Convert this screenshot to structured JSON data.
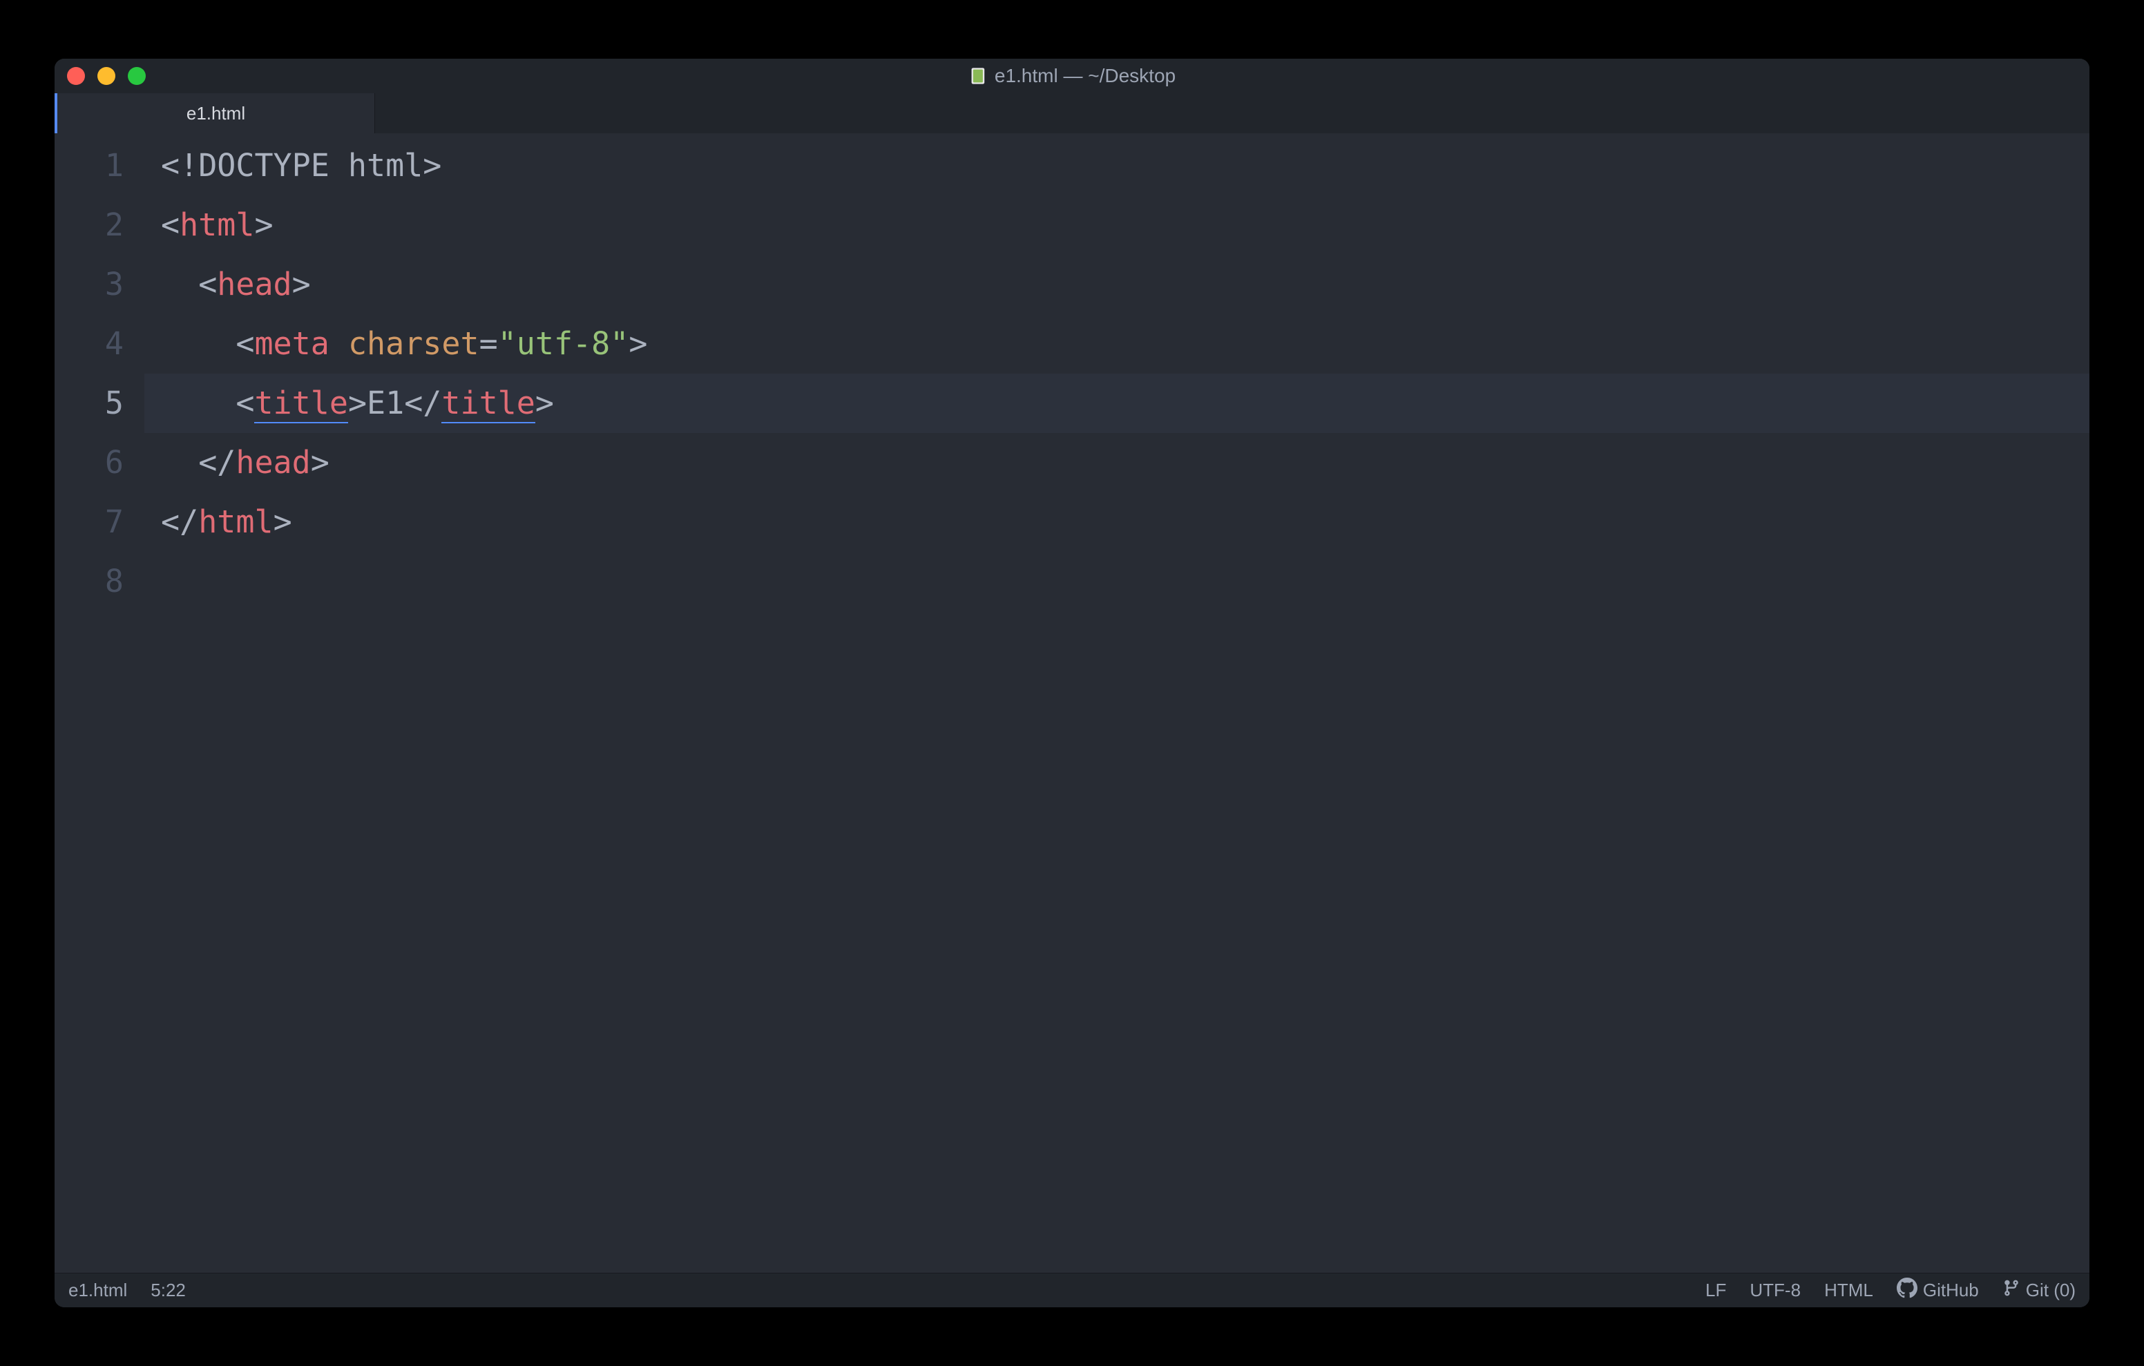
{
  "titlebar": {
    "title": "e1.html — ~/Desktop"
  },
  "tabs": {
    "active": "e1.html"
  },
  "editor": {
    "current_line": 5,
    "lines": [
      {
        "num": "1",
        "tokens": [
          {
            "t": "<!",
            "c": "tok-punct"
          },
          {
            "t": "DOCTYPE html",
            "c": "tok-punct"
          },
          {
            "t": ">",
            "c": "tok-punct"
          }
        ]
      },
      {
        "num": "2",
        "tokens": [
          {
            "t": "<",
            "c": "tok-punct"
          },
          {
            "t": "html",
            "c": "tok-tag"
          },
          {
            "t": ">",
            "c": "tok-punct"
          }
        ]
      },
      {
        "num": "3",
        "indent": "  ",
        "tokens": [
          {
            "t": "<",
            "c": "tok-punct"
          },
          {
            "t": "head",
            "c": "tok-tag"
          },
          {
            "t": ">",
            "c": "tok-punct"
          }
        ]
      },
      {
        "num": "4",
        "indent": "    ",
        "tokens": [
          {
            "t": "<",
            "c": "tok-punct"
          },
          {
            "t": "meta",
            "c": "tok-tag"
          },
          {
            "t": " ",
            "c": ""
          },
          {
            "t": "charset",
            "c": "tok-attr"
          },
          {
            "t": "=",
            "c": "tok-punct"
          },
          {
            "t": "\"utf-8\"",
            "c": "tok-str"
          },
          {
            "t": ">",
            "c": "tok-punct"
          }
        ]
      },
      {
        "num": "5",
        "indent": "    ",
        "tokens": [
          {
            "t": "<",
            "c": "tok-punct"
          },
          {
            "t": "title",
            "c": "tok-tag tok-underline"
          },
          {
            "t": ">",
            "c": "tok-punct"
          },
          {
            "t": "E1",
            "c": ""
          },
          {
            "t": "</",
            "c": "tok-punct"
          },
          {
            "t": "title",
            "c": "tok-tag tok-underline"
          },
          {
            "t": ">",
            "c": "tok-punct"
          }
        ]
      },
      {
        "num": "6",
        "indent": "  ",
        "tokens": [
          {
            "t": "</",
            "c": "tok-punct"
          },
          {
            "t": "head",
            "c": "tok-tag"
          },
          {
            "t": ">",
            "c": "tok-punct"
          }
        ]
      },
      {
        "num": "7",
        "tokens": [
          {
            "t": "</",
            "c": "tok-punct"
          },
          {
            "t": "html",
            "c": "tok-tag"
          },
          {
            "t": ">",
            "c": "tok-punct"
          }
        ]
      },
      {
        "num": "8",
        "tokens": []
      }
    ]
  },
  "statusbar": {
    "filename": "e1.html",
    "cursor": "5:22",
    "eol": "LF",
    "encoding": "UTF-8",
    "language": "HTML",
    "github": "GitHub",
    "git": "Git (0)"
  }
}
